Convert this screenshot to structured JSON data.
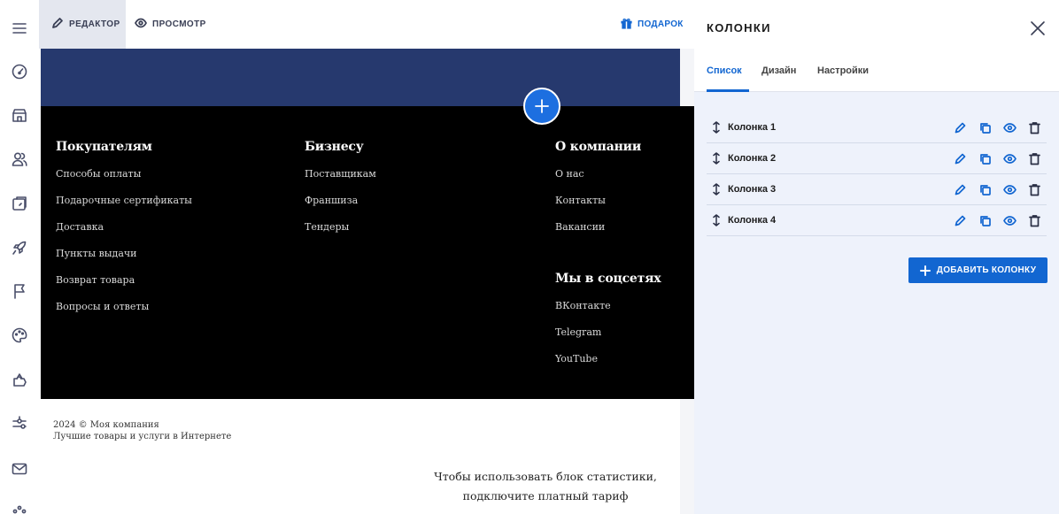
{
  "topbar": {
    "editor_label": "РЕДАКТОР",
    "preview_label": "ПРОСМОТР",
    "gift_label": "ПОДАРОК"
  },
  "rail": {
    "icons": [
      "menu-icon",
      "dashboard-icon",
      "store-icon",
      "users-icon",
      "pages-icon",
      "rocket-icon",
      "flag-icon",
      "palette-icon",
      "puzzle-icon",
      "settings-sliders-icon",
      "mail-icon",
      "more-icon"
    ]
  },
  "footer": {
    "columns": [
      {
        "title": "Покупателям",
        "links": [
          "Способы оплаты",
          "Подарочные сертификаты",
          "Доставка",
          "Пункты выдачи",
          "Возврат товара",
          "Вопросы и ответы"
        ]
      },
      {
        "title": "Бизнесу",
        "links": [
          "Поставщикам",
          "Франшиза",
          "Тендеры"
        ]
      },
      {
        "title": "О компании",
        "links": [
          "О нас",
          "Контакты",
          "Вакансии"
        ],
        "title2": "Мы в соцсетях",
        "links2": [
          "ВКонтакте",
          "Telegram",
          "YouTube"
        ]
      }
    ],
    "copyright": "2024 © Моя компания",
    "tagline": "Лучшие товары и услуги в Интернете",
    "stats_line1": "Чтобы использовать блок статистики,",
    "stats_line2": "подключите платный тариф"
  },
  "panel": {
    "title": "КОЛОНКИ",
    "tabs": [
      {
        "label": "Список",
        "active": true
      },
      {
        "label": "Дизайн",
        "active": false
      },
      {
        "label": "Настройки",
        "active": false
      }
    ],
    "items": [
      {
        "label": "Колонка 1"
      },
      {
        "label": "Колонка 2"
      },
      {
        "label": "Колонка 3"
      },
      {
        "label": "Колонка 4"
      }
    ],
    "add_button_label": "ДОБАВИТЬ КОЛОНКУ"
  },
  "colors": {
    "accent": "#1266d1",
    "header_band": "#26396e",
    "footer_bg": "#000000",
    "panel_bg": "#eef2fb"
  }
}
